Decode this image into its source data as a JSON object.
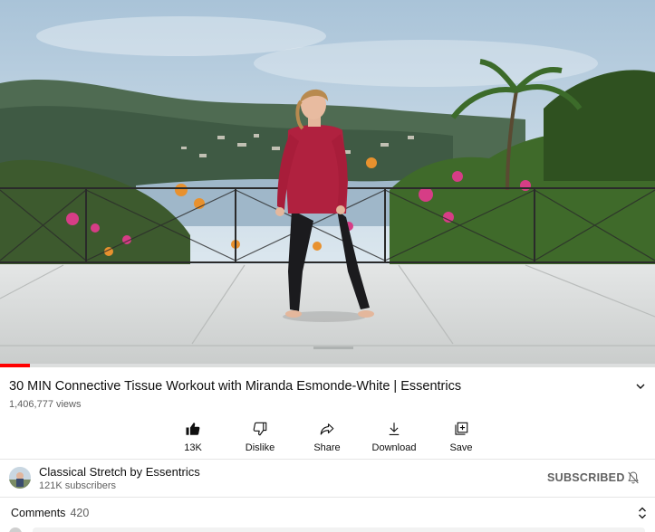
{
  "video": {
    "progress_fraction": 0.045,
    "colors": {
      "progress": "#ff0000",
      "sky": "#cfe0ee",
      "shirt": "#b0213f"
    }
  },
  "title": "30 MIN Connective Tissue Workout with Miranda Esmonde-White | Essentrics",
  "views": "1,406,777 views",
  "actions": [
    {
      "icon": "thumbs-up-filled-icon",
      "label": "13K"
    },
    {
      "icon": "thumbs-down-icon",
      "label": "Dislike"
    },
    {
      "icon": "share-icon",
      "label": "Share"
    },
    {
      "icon": "download-icon",
      "label": "Download"
    },
    {
      "icon": "save-playlist-icon",
      "label": "Save"
    }
  ],
  "channel": {
    "name": "Classical Stretch by Essentrics",
    "subscribers": "121K subscribers",
    "subscribe_state": "SUBSCRIBED"
  },
  "comments": {
    "label": "Comments",
    "count": "420"
  }
}
